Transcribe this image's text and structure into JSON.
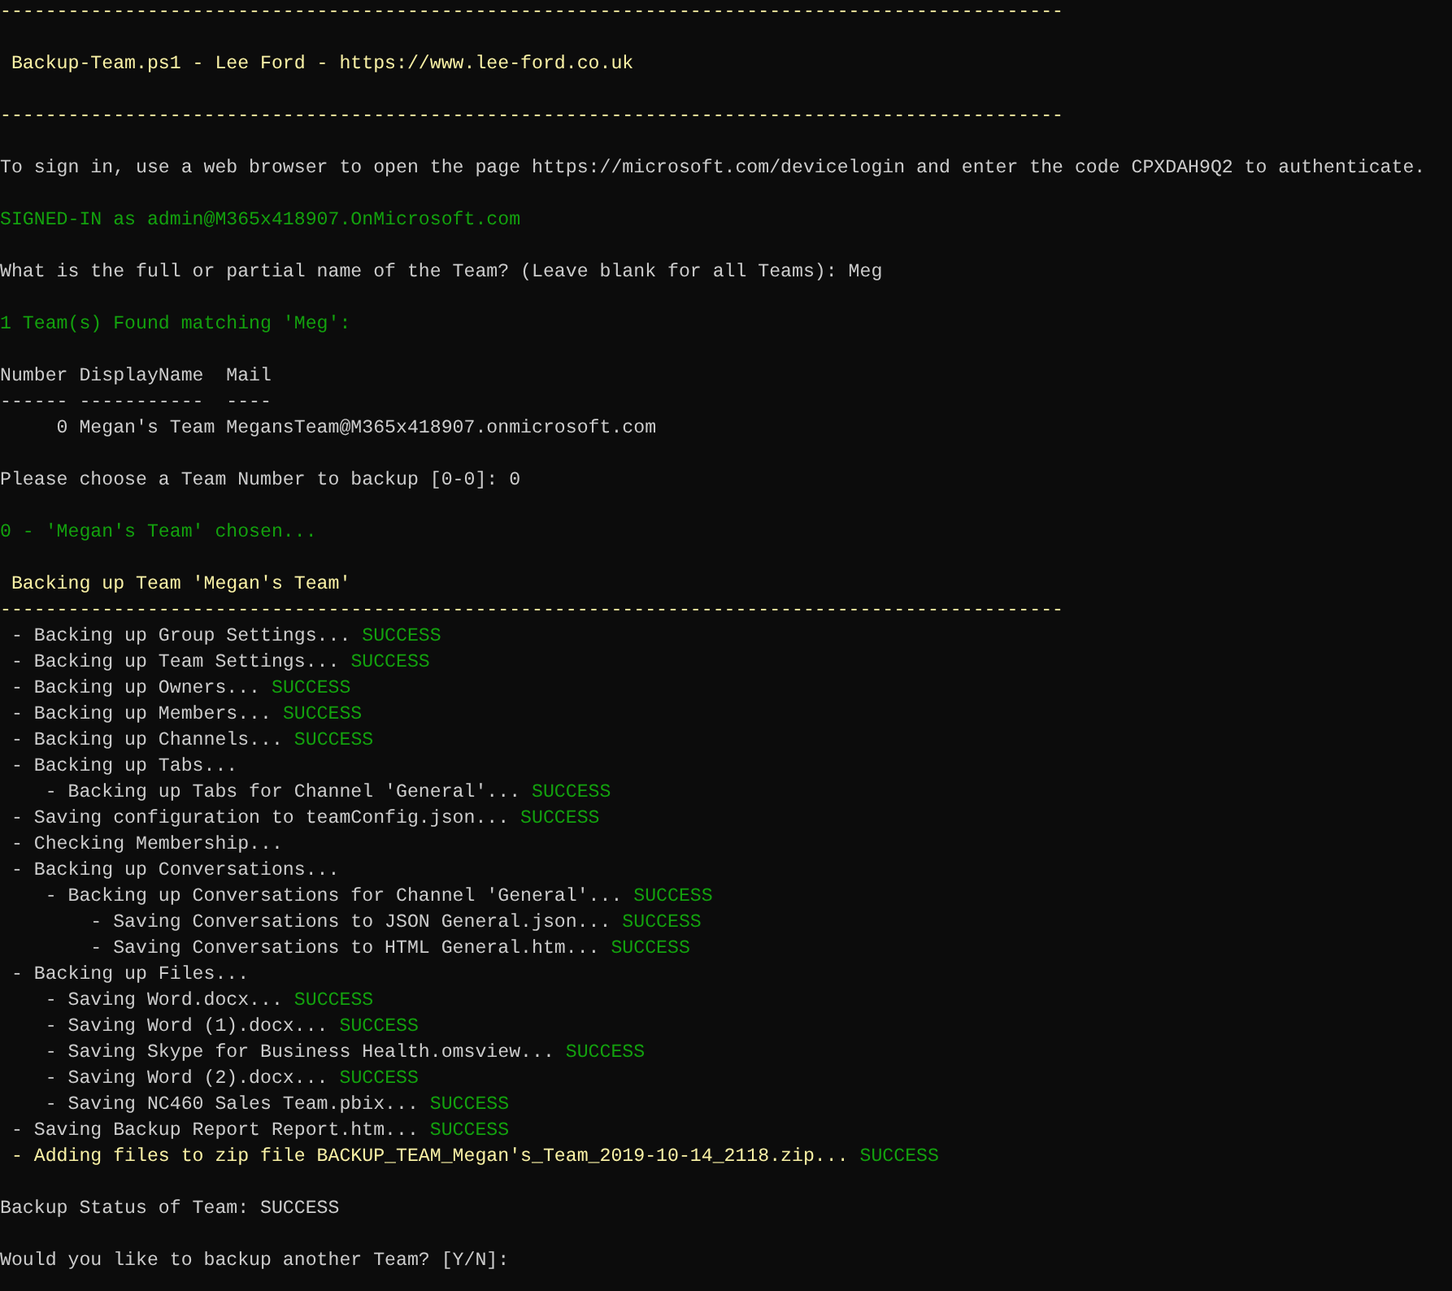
{
  "console": {
    "lines": [
      {
        "gap_after": true,
        "segments": [
          {
            "text": "----------------------------------------------------------------------------------------------",
            "kind": "heading"
          }
        ]
      },
      {
        "gap_after": true,
        "segments": [
          {
            "text": " Backup-Team.ps1 - Lee Ford - https://www.lee-ford.co.uk",
            "kind": "heading"
          }
        ]
      },
      {
        "gap_after": true,
        "segments": [
          {
            "text": "----------------------------------------------------------------------------------------------",
            "kind": "heading"
          }
        ]
      },
      {
        "gap_after": true,
        "segments": [
          {
            "text": "To sign in, use a web browser to open the page https://microsoft.com/devicelogin and enter the code CPXDAH9Q2 to authenticate.",
            "kind": "plain"
          }
        ]
      },
      {
        "gap_after": true,
        "segments": [
          {
            "text": "SIGNED-IN as admin@M365x418907.OnMicrosoft.com",
            "kind": "success"
          }
        ]
      },
      {
        "gap_after": true,
        "segments": [
          {
            "text": "What is the full or partial name of the Team? (Leave blank for all Teams): Meg",
            "kind": "plain"
          }
        ]
      },
      {
        "gap_after": true,
        "segments": [
          {
            "text": "1 Team(s) Found matching 'Meg':",
            "kind": "success"
          }
        ]
      },
      {
        "gap_after": false,
        "segments": [
          {
            "text": "Number DisplayName  Mail",
            "kind": "plain"
          }
        ]
      },
      {
        "gap_after": false,
        "segments": [
          {
            "text": "------ -----------  ----",
            "kind": "plain"
          }
        ]
      },
      {
        "gap_after": true,
        "segments": [
          {
            "text": "     0 Megan's Team MegansTeam@M365x418907.onmicrosoft.com",
            "kind": "plain"
          }
        ]
      },
      {
        "gap_after": true,
        "segments": [
          {
            "text": "Please choose a Team Number to backup [0-0]: 0",
            "kind": "plain"
          }
        ]
      },
      {
        "gap_after": true,
        "segments": [
          {
            "text": "0 - 'Megan's Team' chosen...",
            "kind": "success"
          }
        ]
      },
      {
        "gap_after": false,
        "segments": [
          {
            "text": " Backing up Team 'Megan's Team'",
            "kind": "heading"
          }
        ]
      },
      {
        "gap_after": false,
        "segments": [
          {
            "text": "----------------------------------------------------------------------------------------------",
            "kind": "heading"
          }
        ]
      },
      {
        "gap_after": false,
        "segments": [
          {
            "text": " - Backing up Group Settings... ",
            "kind": "plain"
          },
          {
            "text": "SUCCESS",
            "kind": "success"
          }
        ]
      },
      {
        "gap_after": false,
        "segments": [
          {
            "text": " - Backing up Team Settings... ",
            "kind": "plain"
          },
          {
            "text": "SUCCESS",
            "kind": "success"
          }
        ]
      },
      {
        "gap_after": false,
        "segments": [
          {
            "text": " - Backing up Owners... ",
            "kind": "plain"
          },
          {
            "text": "SUCCESS",
            "kind": "success"
          }
        ]
      },
      {
        "gap_after": false,
        "segments": [
          {
            "text": " - Backing up Members... ",
            "kind": "plain"
          },
          {
            "text": "SUCCESS",
            "kind": "success"
          }
        ]
      },
      {
        "gap_after": false,
        "segments": [
          {
            "text": " - Backing up Channels... ",
            "kind": "plain"
          },
          {
            "text": "SUCCESS",
            "kind": "success"
          }
        ]
      },
      {
        "gap_after": false,
        "segments": [
          {
            "text": " - Backing up Tabs...",
            "kind": "plain"
          }
        ]
      },
      {
        "gap_after": false,
        "segments": [
          {
            "text": "    - Backing up Tabs for Channel 'General'... ",
            "kind": "plain"
          },
          {
            "text": "SUCCESS",
            "kind": "success"
          }
        ]
      },
      {
        "gap_after": false,
        "segments": [
          {
            "text": " - Saving configuration to teamConfig.json... ",
            "kind": "plain"
          },
          {
            "text": "SUCCESS",
            "kind": "success"
          }
        ]
      },
      {
        "gap_after": false,
        "segments": [
          {
            "text": " - Checking Membership...",
            "kind": "plain"
          }
        ]
      },
      {
        "gap_after": false,
        "segments": [
          {
            "text": " - Backing up Conversations...",
            "kind": "plain"
          }
        ]
      },
      {
        "gap_after": false,
        "segments": [
          {
            "text": "    - Backing up Conversations for Channel 'General'... ",
            "kind": "plain"
          },
          {
            "text": "SUCCESS",
            "kind": "success"
          }
        ]
      },
      {
        "gap_after": false,
        "segments": [
          {
            "text": "        - Saving Conversations to JSON General.json... ",
            "kind": "plain"
          },
          {
            "text": "SUCCESS",
            "kind": "success"
          }
        ]
      },
      {
        "gap_after": false,
        "segments": [
          {
            "text": "        - Saving Conversations to HTML General.htm... ",
            "kind": "plain"
          },
          {
            "text": "SUCCESS",
            "kind": "success"
          }
        ]
      },
      {
        "gap_after": false,
        "segments": [
          {
            "text": " - Backing up Files...",
            "kind": "plain"
          }
        ]
      },
      {
        "gap_after": false,
        "segments": [
          {
            "text": "    - Saving Word.docx... ",
            "kind": "plain"
          },
          {
            "text": "SUCCESS",
            "kind": "success"
          }
        ]
      },
      {
        "gap_after": false,
        "segments": [
          {
            "text": "    - Saving Word (1).docx... ",
            "kind": "plain"
          },
          {
            "text": "SUCCESS",
            "kind": "success"
          }
        ]
      },
      {
        "gap_after": false,
        "segments": [
          {
            "text": "    - Saving Skype for Business Health.omsview... ",
            "kind": "plain"
          },
          {
            "text": "SUCCESS",
            "kind": "success"
          }
        ]
      },
      {
        "gap_after": false,
        "segments": [
          {
            "text": "    - Saving Word (2).docx... ",
            "kind": "plain"
          },
          {
            "text": "SUCCESS",
            "kind": "success"
          }
        ]
      },
      {
        "gap_after": false,
        "segments": [
          {
            "text": "    - Saving NC460 Sales Team.pbix... ",
            "kind": "plain"
          },
          {
            "text": "SUCCESS",
            "kind": "success"
          }
        ]
      },
      {
        "gap_after": false,
        "segments": [
          {
            "text": " - Saving Backup Report Report.htm... ",
            "kind": "plain"
          },
          {
            "text": "SUCCESS",
            "kind": "success"
          }
        ]
      },
      {
        "gap_after": true,
        "segments": [
          {
            "text": " - Adding files to zip file BACKUP_TEAM_Megan's_Team_2019-10-14_2118.zip... ",
            "kind": "heading"
          },
          {
            "text": "SUCCESS",
            "kind": "success"
          }
        ]
      },
      {
        "gap_after": true,
        "segments": [
          {
            "text": "Backup Status of Team: SUCCESS",
            "kind": "plain"
          }
        ]
      },
      {
        "gap_after": false,
        "segments": [
          {
            "text": "Would you like to backup another Team? [Y/N]:",
            "kind": "plain"
          }
        ]
      }
    ]
  }
}
